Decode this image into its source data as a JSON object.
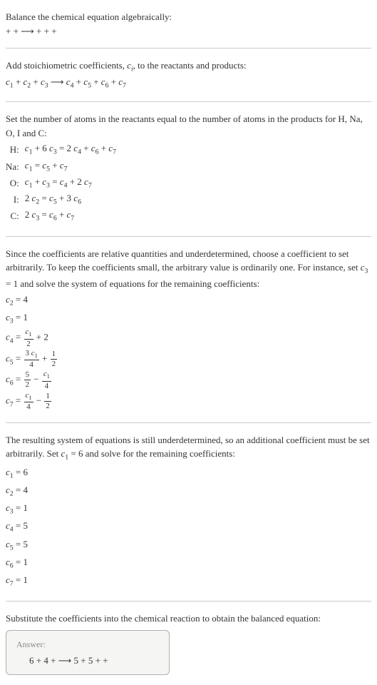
{
  "intro": {
    "line1": "Balance the chemical equation algebraically:",
    "line2": " +  +  ⟶  +  +  + "
  },
  "stoich": {
    "text": "Add stoichiometric coefficients, c_i, to the reactants and products:",
    "eq": "c₁  + c₂  + c₃  ⟶ c₄  + c₅  + c₆  + c₇"
  },
  "atoms": {
    "text": "Set the number of atoms in the reactants equal to the number of atoms in the products for H, Na, O, I and C:",
    "rows": [
      {
        "label": "H:",
        "eq": "c₁ + 6 c₃ = 2 c₄ + c₆ + c₇"
      },
      {
        "label": "Na:",
        "eq": "c₁ = c₅ + c₇"
      },
      {
        "label": "O:",
        "eq": "c₁ + c₃ = c₄ + 2 c₇"
      },
      {
        "label": "I:",
        "eq": "2 c₂ = c₅ + 3 c₆"
      },
      {
        "label": "C:",
        "eq": "2 c₃ = c₆ + c₇"
      }
    ]
  },
  "under1": {
    "text": "Since the coefficients are relative quantities and underdetermined, choose a coefficient to set arbitrarily. To keep the coefficients small, the arbitrary value is ordinarily one. For instance, set c₃ = 1 and solve the system of equations for the remaining coefficients:",
    "coeffs_simple": [
      "c₂ = 4",
      "c₃ = 1"
    ],
    "c4": {
      "lead": "c₄ = ",
      "num": "c₁",
      "den": "2",
      "tail": " + 2"
    },
    "c5": {
      "lead": "c₅ = ",
      "num": "3 c₁",
      "den": "4",
      "tail_num": "1",
      "tail_den": "2",
      "op": " + "
    },
    "c6": {
      "lead": "c₆ = ",
      "num": "5",
      "den": "2",
      "op": " − ",
      "num2": "c₁",
      "den2": "4"
    },
    "c7": {
      "lead": "c₇ = ",
      "num": "c₁",
      "den": "4",
      "op": " − ",
      "num2": "1",
      "den2": "2"
    }
  },
  "under2": {
    "text": "The resulting system of equations is still underdetermined, so an additional coefficient must be set arbitrarily. Set c₁ = 6 and solve for the remaining coefficients:",
    "coeffs": [
      "c₁ = 6",
      "c₂ = 4",
      "c₃ = 1",
      "c₄ = 5",
      "c₅ = 5",
      "c₆ = 1",
      "c₇ = 1"
    ]
  },
  "final": {
    "text": "Substitute the coefficients into the chemical reaction to obtain the balanced equation:",
    "answer_label": "Answer:",
    "answer_eq": "6  + 4  +  ⟶ 5  + 5  +  + "
  }
}
